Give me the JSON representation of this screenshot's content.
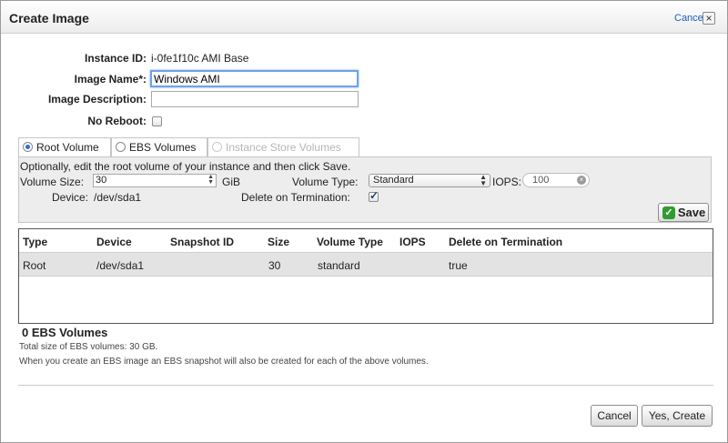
{
  "dialog": {
    "title": "Create Image",
    "cancel_link": "Cancel",
    "close_glyph": "×"
  },
  "form": {
    "instance_id_label": "Instance ID:",
    "instance_id_value": "i-0fe1f10c AMI Base",
    "image_name_label": "Image Name*:",
    "image_name_value": "Windows AMI",
    "image_description_label": "Image Description:",
    "image_description_value": "",
    "no_reboot_label": "No Reboot:",
    "no_reboot_checked": false
  },
  "tabs": [
    {
      "label": "Root Volume",
      "selected": true,
      "disabled": false
    },
    {
      "label": "EBS Volumes",
      "selected": false,
      "disabled": false
    },
    {
      "label": "Instance Store Volumes",
      "selected": false,
      "disabled": true
    }
  ],
  "root_panel": {
    "instructions": "Optionally, edit the root volume of your instance and then click Save.",
    "volume_size_label": "Volume Size:",
    "volume_size_value": "30",
    "volume_size_unit": "GiB",
    "volume_type_label": "Volume Type:",
    "volume_type_value": "Standard",
    "iops_label": "IOPS:",
    "iops_placeholder": "100",
    "device_label": "Device:",
    "device_value": "/dev/sda1",
    "delete_on_termination_label": "Delete on Termination:",
    "delete_on_termination_checked": true,
    "save_button": "Save"
  },
  "table": {
    "columns": [
      "Type",
      "Device",
      "Snapshot ID",
      "Size",
      "Volume Type",
      "IOPS",
      "Delete on Termination"
    ],
    "rows": [
      {
        "type": "Root",
        "device": "/dev/sda1",
        "snapshot_id": "",
        "size": "30",
        "volume_type": "standard",
        "iops": "",
        "delete_on_termination": "true"
      }
    ]
  },
  "summary": {
    "ebs_count": "0 EBS Volumes",
    "total_size": "Total size of EBS volumes: 30 GB.",
    "note": "When you create an EBS image an EBS snapshot will also be created for each of the above volumes."
  },
  "footer": {
    "cancel_button": "Cancel",
    "create_button": "Yes, Create"
  },
  "colors": {
    "link": "#1a5fb4",
    "focus": "#6ea2e8",
    "save_icon": "#2f9c2f",
    "selected_row": "#e3e3e3"
  }
}
